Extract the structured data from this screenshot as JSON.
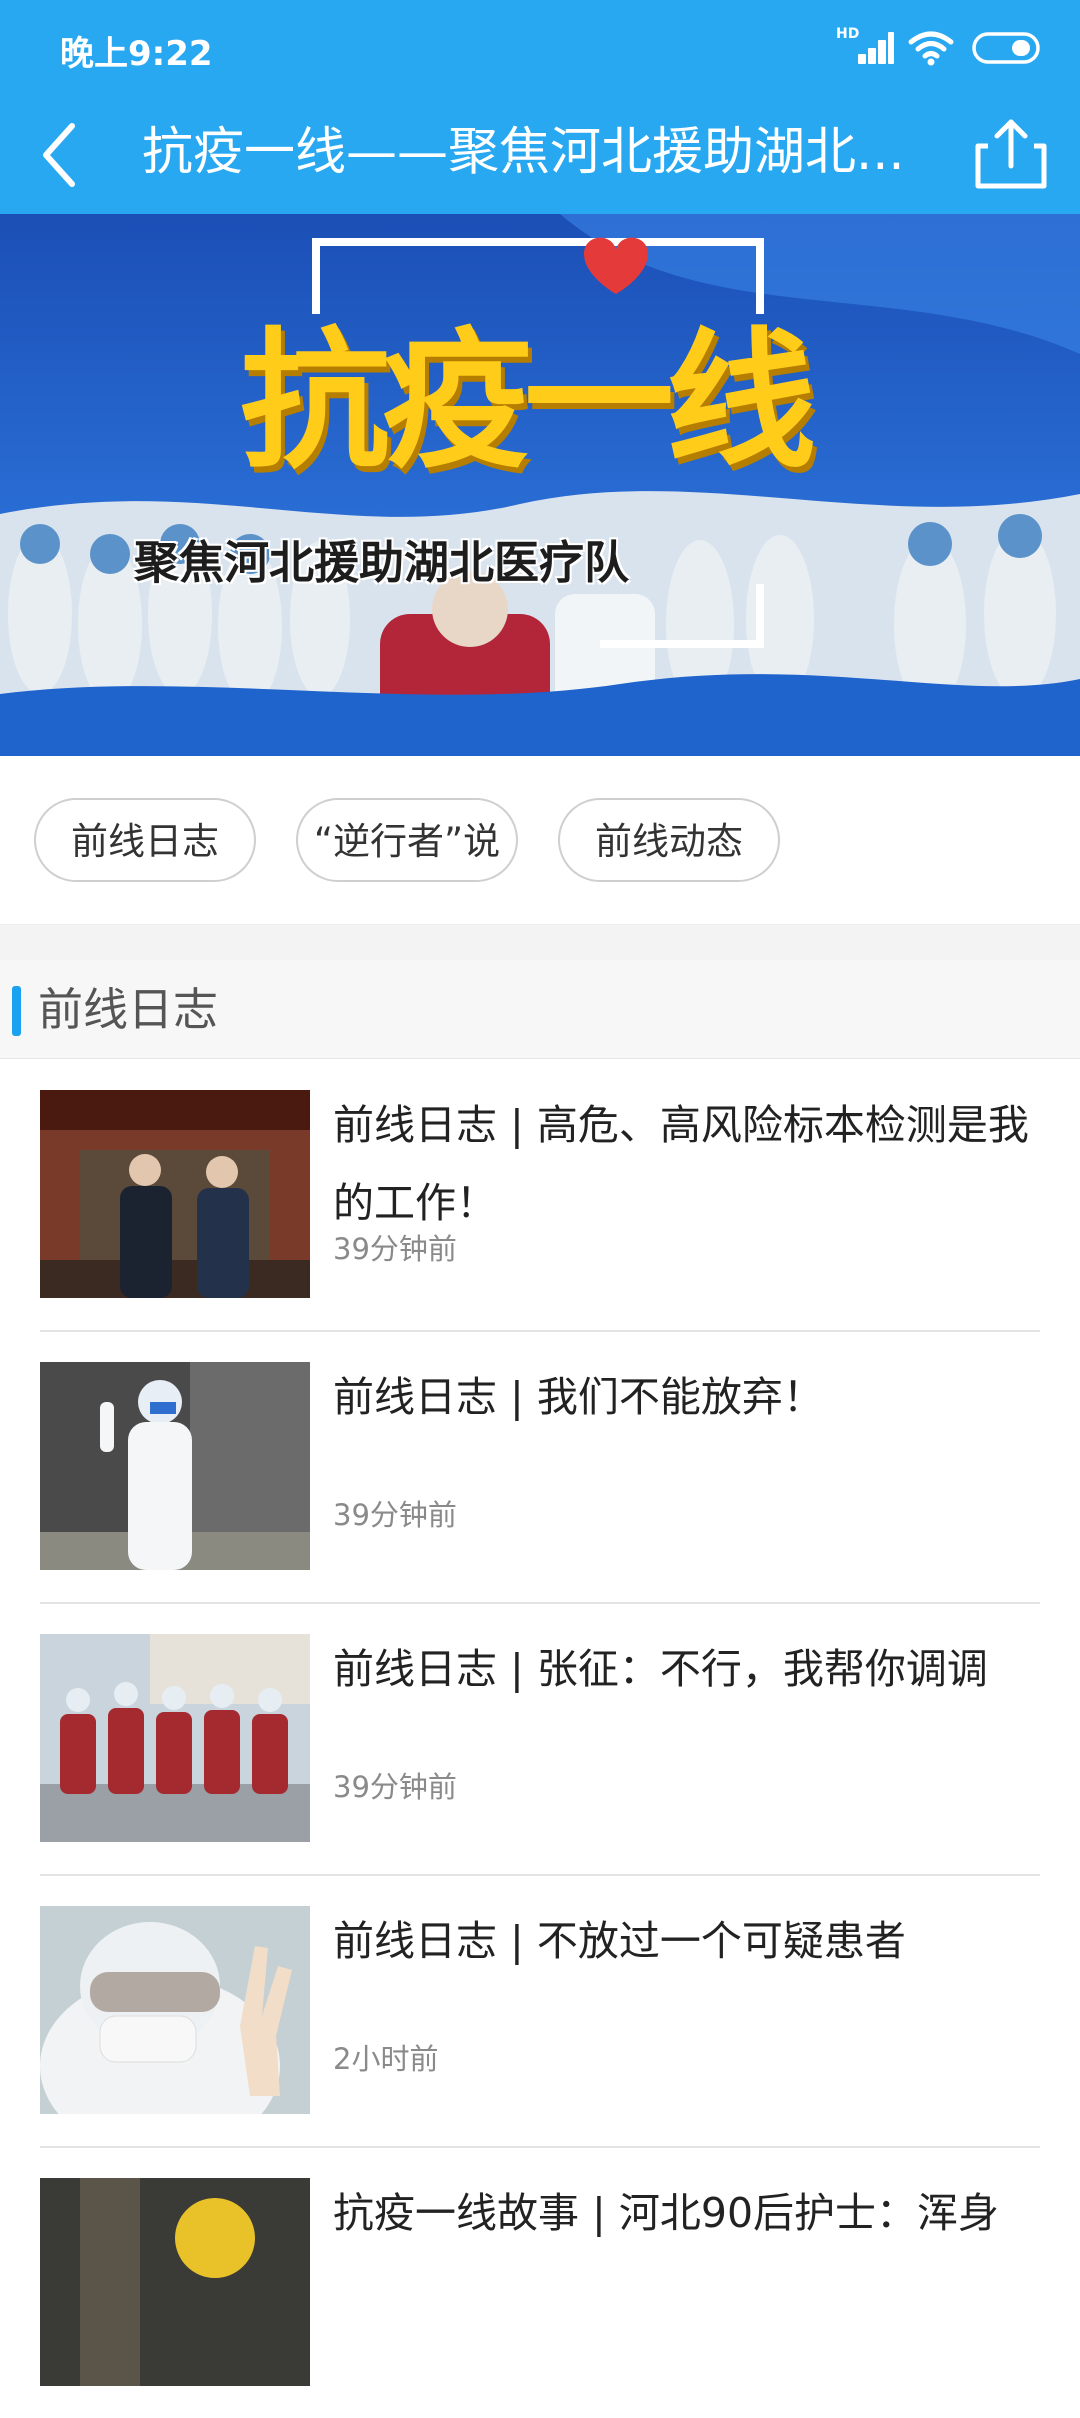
{
  "status_bar": {
    "time": "晚上9:22",
    "network_label": "HD",
    "icons": [
      "signal-icon",
      "wifi-icon",
      "battery-icon"
    ]
  },
  "app_bar": {
    "title": "抗疫一线——聚焦河北援助湖北...",
    "back_icon": "back-chevron-icon",
    "share_icon": "share-icon",
    "background": "#29a8f2"
  },
  "banner": {
    "title": "抗疫一线",
    "subtitle": "聚焦河北援助湖北医疗队"
  },
  "tabs": [
    {
      "label": "前线日志"
    },
    {
      "label": "“逆行者”说"
    },
    {
      "label": "前线动态"
    }
  ],
  "section": {
    "title": "前线日志",
    "accent_color": "#1aa2f0"
  },
  "news": [
    {
      "title": "前线日志 | 高危、高风险标本检测是我的工作！",
      "time": "39分钟前"
    },
    {
      "title": "前线日志 | 我们不能放弃！",
      "time": "39分钟前"
    },
    {
      "title": "前线日志 | 张征：不行，我帮你调调",
      "time": "39分钟前"
    },
    {
      "title": "前线日志 | 不放过一个可疑患者",
      "time": "2小时前"
    },
    {
      "title": "抗疫一线故事 | 河北90后护士：浑身",
      "time": ""
    }
  ]
}
